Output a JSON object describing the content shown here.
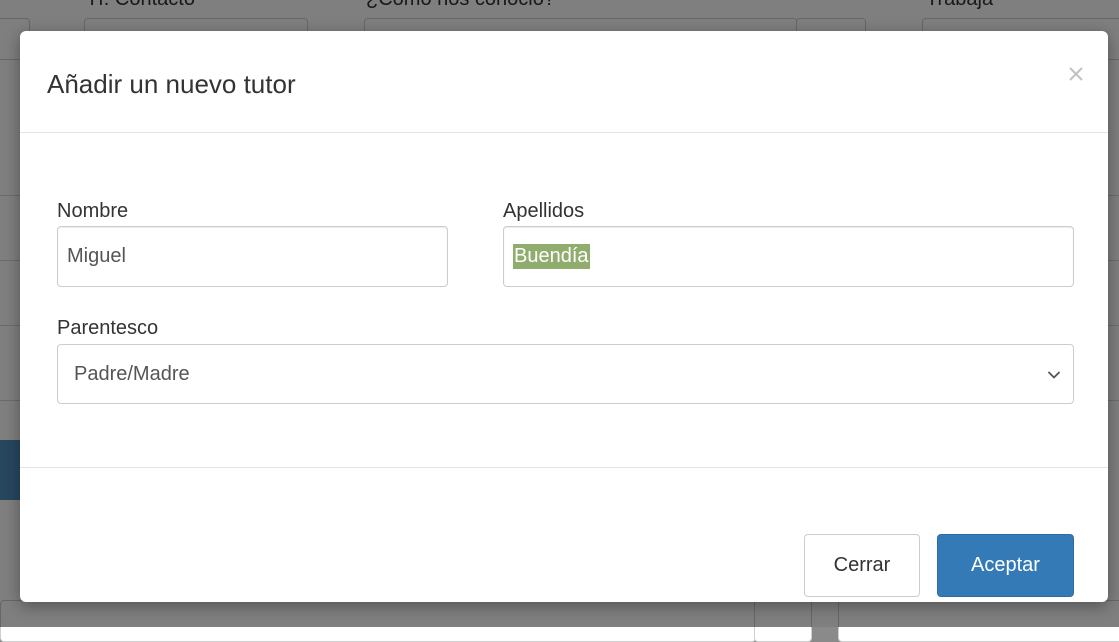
{
  "background": {
    "labels": [
      "Tf. Contacto",
      "¿Cómo nos conoció?",
      "Trabaja"
    ]
  },
  "modal": {
    "title": "Añadir un nuevo tutor",
    "close_symbol": "×",
    "close_icon": "close-icon",
    "fields": {
      "nombre": {
        "label": "Nombre",
        "value": "Miguel"
      },
      "apellidos": {
        "label": "Apellidos",
        "value": "Buendía",
        "selected": true
      },
      "parentesco": {
        "label": "Parentesco",
        "value": "Padre/Madre",
        "icon": "chevron-down-icon"
      }
    },
    "buttons": {
      "close_label": "Cerrar",
      "accept_label": "Aceptar"
    }
  },
  "colors": {
    "primary": "#337ab7",
    "primary_border": "#2e6da4",
    "text_selection": "#90ad6e",
    "backdrop": "#000000"
  }
}
